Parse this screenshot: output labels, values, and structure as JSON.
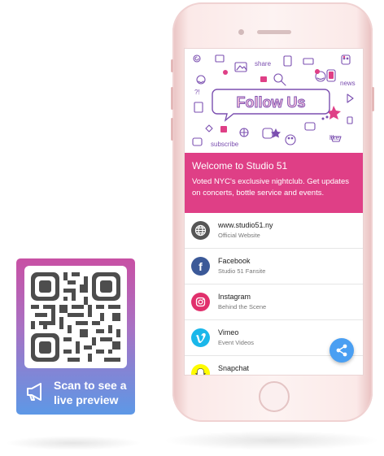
{
  "qr_card": {
    "caption": "Scan to see a live preview",
    "icon": "megaphone-icon"
  },
  "phone": {
    "banner": {
      "headline": "Follow Us",
      "doodle_words": [
        "share",
        "news",
        "like",
        "subscribe",
        "?!"
      ]
    },
    "welcome": {
      "title": "Welcome to Studio 51",
      "description": "Voted NYC's exclusive nightclub. Get updates on concerts, bottle service and events."
    },
    "links": [
      {
        "title": "www.studio51.ny",
        "subtitle": "Official Website",
        "icon": "globe-icon",
        "color": "#555555"
      },
      {
        "title": "Facebook",
        "subtitle": "Studio 51 Fansite",
        "icon": "facebook-icon",
        "color": "#3b5998"
      },
      {
        "title": "Instagram",
        "subtitle": "Behind the Scene",
        "icon": "instagram-icon",
        "color": "#e1306c"
      },
      {
        "title": "Vimeo",
        "subtitle": "Event Videos",
        "icon": "vimeo-icon",
        "color": "#1ab7ea"
      },
      {
        "title": "Snapchat",
        "subtitle": "",
        "icon": "snapchat-icon",
        "color": "#fffc00"
      }
    ],
    "share_button": {
      "icon": "share-icon",
      "color": "#4a9ff2"
    }
  },
  "colors": {
    "accent": "#df3f86",
    "qr_gradient_top": "#c850a4",
    "qr_gradient_bottom": "#5d98e6"
  }
}
